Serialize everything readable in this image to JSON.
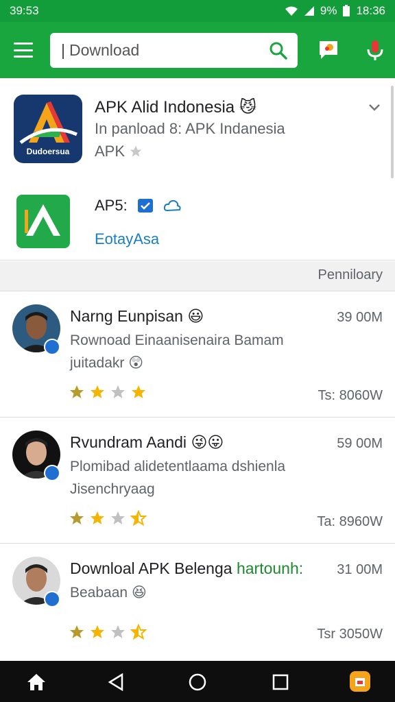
{
  "status": {
    "time_left": "39:53",
    "battery": "9%",
    "time_right": "18:36"
  },
  "search": {
    "value": "Download",
    "placeholder": ""
  },
  "featured": {
    "title": "APK Alid Indonesia",
    "subtitle": "In panload 8: APK Indanesia",
    "meta": "APK",
    "logo_caption": "Dudoersua",
    "second_label": "AP5:",
    "second_link": "EotayAsa"
  },
  "section": {
    "label": "Penniloary"
  },
  "items": [
    {
      "name": "Narng Eunpisan",
      "desc": "Rownoad Einaanisenaira Bamam juitadakr",
      "size": "39 00M",
      "count": "Ts: 8060W",
      "rating": 3
    },
    {
      "name": "Rvundram Aandi",
      "desc": "Plomibad alidetentlaama dshienla Jisenchryaag",
      "size": "59 00M",
      "count": "Ta: 8960W",
      "rating": 2.5
    },
    {
      "name": "Downloal APK Belenga",
      "name_extra": "hartounh:",
      "desc": "Beabaan",
      "size": "31 00M",
      "count": "Tsr 3050W",
      "rating": 2.5
    }
  ],
  "colors": {
    "primary": "#1aa63f",
    "star": "#f5b400",
    "badge": "#1e6fd0"
  }
}
